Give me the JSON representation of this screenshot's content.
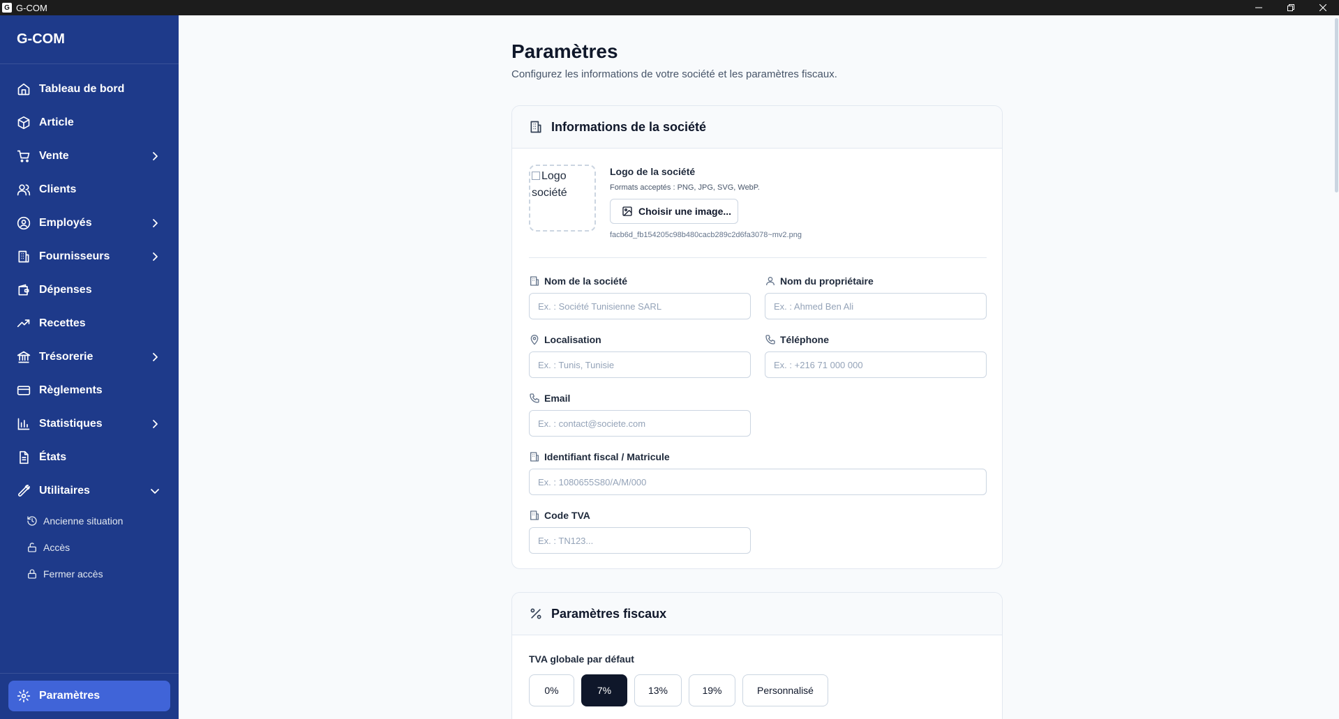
{
  "window": {
    "title": "G-COM",
    "icon_letter": "G"
  },
  "sidebar": {
    "brand": "G-COM",
    "items": [
      {
        "label": "Tableau de bord",
        "icon": "home-icon",
        "chevron": false
      },
      {
        "label": "Article",
        "icon": "package-icon",
        "chevron": false
      },
      {
        "label": "Vente",
        "icon": "cart-icon",
        "chevron": true
      },
      {
        "label": "Clients",
        "icon": "users-icon",
        "chevron": false
      },
      {
        "label": "Employés",
        "icon": "user-circle-icon",
        "chevron": true
      },
      {
        "label": "Fournisseurs",
        "icon": "building-icon",
        "chevron": true
      },
      {
        "label": "Dépenses",
        "icon": "wallet-icon",
        "chevron": false
      },
      {
        "label": "Recettes",
        "icon": "trending-up-icon",
        "chevron": false
      },
      {
        "label": "Trésorerie",
        "icon": "bank-icon",
        "chevron": true
      },
      {
        "label": "Règlements",
        "icon": "credit-card-icon",
        "chevron": false
      },
      {
        "label": "Statistiques",
        "icon": "bar-chart-icon",
        "chevron": true
      },
      {
        "label": "États",
        "icon": "document-icon",
        "chevron": false
      },
      {
        "label": "Utilitaires",
        "icon": "wrench-icon",
        "chevron": true,
        "expanded": true
      }
    ],
    "sub_items": [
      {
        "label": "Ancienne situation",
        "icon": "history-icon"
      },
      {
        "label": "Accès",
        "icon": "unlock-icon"
      },
      {
        "label": "Fermer accès",
        "icon": "lock-icon"
      }
    ],
    "footer": {
      "label": "Paramètres",
      "icon": "gear-icon"
    }
  },
  "page": {
    "title": "Paramètres",
    "subtitle": "Configurez les informations de votre société et les paramètres fiscaux."
  },
  "company_card": {
    "title": "Informations de la société",
    "logo": {
      "alt_text": "Logo société",
      "label": "Logo de la société",
      "hint": "Formats acceptés : PNG, JPG, SVG, WebP.",
      "button": "Choisir une image...",
      "filename": "facb6d_fb154205c98b480cacb289c2d6fa3078~mv2.png"
    },
    "fields": {
      "company_name": {
        "label": "Nom de la société",
        "placeholder": "Ex. : Société Tunisienne SARL",
        "value": ""
      },
      "owner_name": {
        "label": "Nom du propriétaire",
        "placeholder": "Ex. : Ahmed Ben Ali",
        "value": ""
      },
      "location": {
        "label": "Localisation",
        "placeholder": "Ex. : Tunis, Tunisie",
        "value": ""
      },
      "phone": {
        "label": "Téléphone",
        "placeholder": "Ex. : +216 71 000 000",
        "value": ""
      },
      "email": {
        "label": "Email",
        "placeholder": "Ex. : contact@societe.com",
        "value": ""
      },
      "tax_id": {
        "label": "Identifiant fiscal / Matricule",
        "placeholder": "Ex. : 1080655S80/A/M/000",
        "value": ""
      },
      "vat_code": {
        "label": "Code TVA",
        "placeholder": "Ex. : TN123...",
        "value": ""
      }
    }
  },
  "fiscal_card": {
    "title": "Paramètres fiscaux",
    "tva_label": "TVA globale par défaut",
    "tva_options": [
      "0%",
      "7%",
      "13%",
      "19%",
      "Personnalisé"
    ],
    "tva_selected": "7%"
  },
  "colors": {
    "sidebar_bg": "#1e3a8a",
    "active_nav": "#4064d8",
    "selected_option": "#0f172a"
  }
}
